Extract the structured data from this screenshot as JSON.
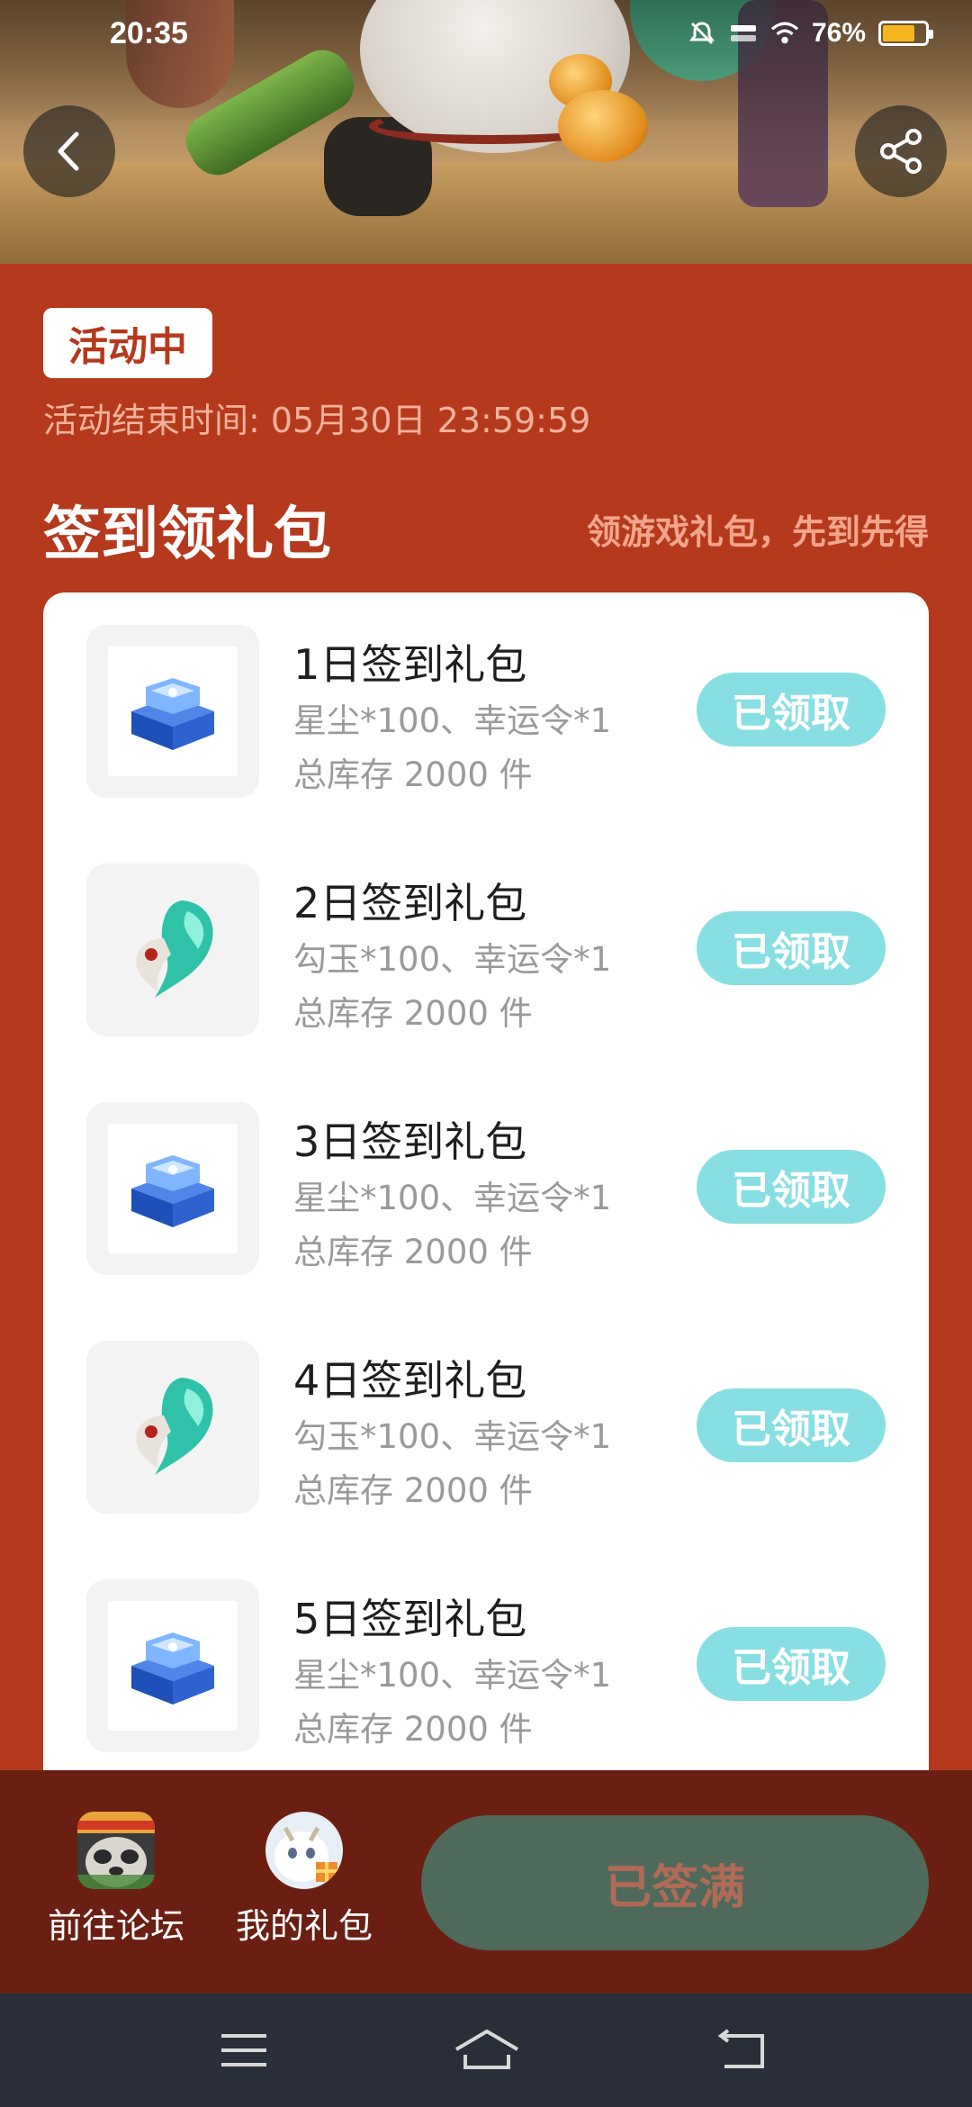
{
  "status_bar": {
    "time": "20:35",
    "battery": "76%",
    "battery_level": 0.76,
    "icons": [
      "mute-bell-icon",
      "network-speed-icon",
      "wifi-icon",
      "battery-icon"
    ]
  },
  "header": {
    "back_icon": "chevron-left-icon",
    "share_icon": "share-icon"
  },
  "activity": {
    "status_badge": "活动中",
    "end_time": "活动结束时间: 05月30日 23:59:59"
  },
  "section": {
    "title": "签到领礼包",
    "subtitle": "领游戏礼包，先到先得"
  },
  "gifts": [
    {
      "name": "1日签到礼包",
      "desc": "星尘*100、幸运令*1",
      "stock": "总库存 2000 件",
      "button": "已领取",
      "icon": "blue-chest-icon"
    },
    {
      "name": "2日签到礼包",
      "desc": "勾玉*100、幸运令*1",
      "stock": "总库存 2000 件",
      "button": "已领取",
      "icon": "jade-magatama-icon"
    },
    {
      "name": "3日签到礼包",
      "desc": "星尘*100、幸运令*1",
      "stock": "总库存 2000 件",
      "button": "已领取",
      "icon": "blue-chest-icon"
    },
    {
      "name": "4日签到礼包",
      "desc": "勾玉*100、幸运令*1",
      "stock": "总库存 2000 件",
      "button": "已领取",
      "icon": "jade-magatama-icon"
    },
    {
      "name": "5日签到礼包",
      "desc": "星尘*100、幸运令*1",
      "stock": "总库存 2000 件",
      "button": "已领取",
      "icon": "blue-chest-icon"
    }
  ],
  "action_bar": {
    "forum": "前往论坛",
    "my_gifts": "我的礼包",
    "main_button": "已签满"
  },
  "nav_bar": {
    "icons": [
      "menu-icon",
      "home-icon",
      "back-icon"
    ]
  },
  "colors": {
    "page_bg": "#b5391c",
    "claimed_button": "#88dfe3",
    "action_bar_bg": "#6a1f12",
    "full_button_bg": "#4f6a5a"
  }
}
